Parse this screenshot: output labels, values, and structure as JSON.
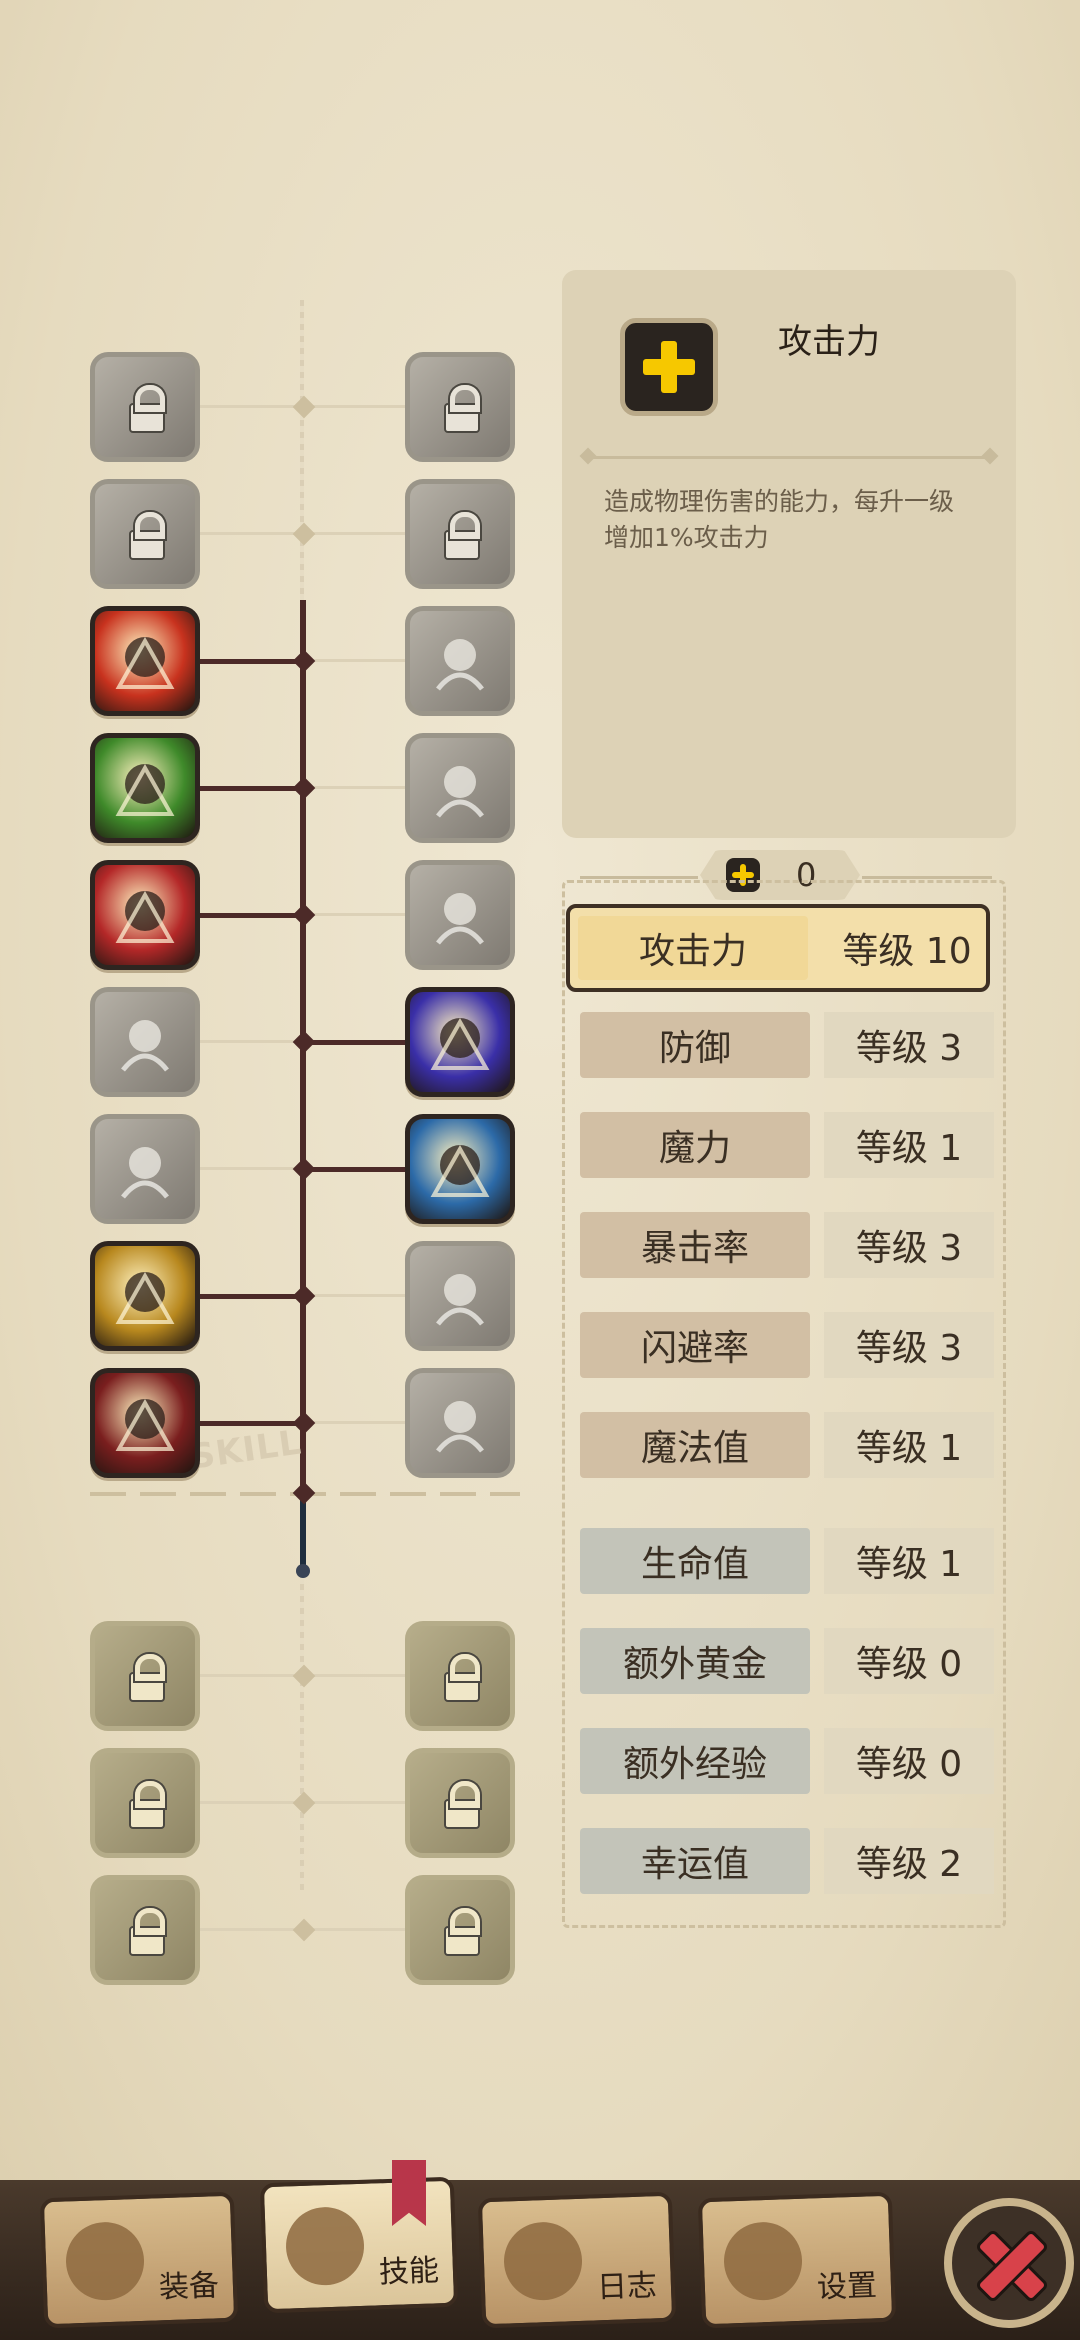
{
  "skill_tree": {
    "watermark": "SKILL",
    "upper_left": [
      {
        "icon": "lightning-wolf-icon",
        "state": "locked"
      },
      {
        "icon": "skull-bird-icon",
        "state": "locked"
      },
      {
        "icon": "fire-rage-icon",
        "state": "unlocked",
        "color": "#c8321e"
      },
      {
        "icon": "green-strength-icon",
        "state": "unlocked",
        "color": "#3f8a2a"
      },
      {
        "icon": "red-slash-icon",
        "state": "unlocked",
        "color": "#b42828"
      },
      {
        "icon": "sword-icon",
        "state": "locked-grey"
      },
      {
        "icon": "whirlwind-icon",
        "state": "locked-grey"
      },
      {
        "icon": "golden-rage-icon",
        "state": "unlocked",
        "color": "#b8881e"
      },
      {
        "icon": "crossed-swords-icon",
        "state": "unlocked",
        "color": "#7a1e1e"
      }
    ],
    "upper_right": [
      {
        "icon": "shield-crest-icon",
        "state": "locked"
      },
      {
        "icon": "blade-storm-icon",
        "state": "locked"
      },
      {
        "icon": "lightning-icon",
        "state": "locked-grey"
      },
      {
        "icon": "dash-icon",
        "state": "locked-grey"
      },
      {
        "icon": "smoke-bomb-icon",
        "state": "locked-grey"
      },
      {
        "icon": "purple-eye-icon",
        "state": "unlocked",
        "color": "#3a2fa8"
      },
      {
        "icon": "ice-blade-icon",
        "state": "unlocked",
        "color": "#2c6aa8"
      },
      {
        "icon": "explosion-icon",
        "state": "locked-grey"
      },
      {
        "icon": "sparkle-icon",
        "state": "locked-grey"
      }
    ],
    "lower_left": [
      {
        "icon": "bag-lock-icon",
        "state": "locked"
      },
      {
        "icon": "crest-lock-icon",
        "state": "locked"
      },
      {
        "icon": "horned-lock-icon",
        "state": "locked"
      }
    ],
    "lower_right": [
      {
        "icon": "eye-lock-icon",
        "state": "locked"
      },
      {
        "icon": "eye-wing-lock-icon",
        "state": "locked"
      },
      {
        "icon": "chain-lock-icon",
        "state": "locked"
      }
    ]
  },
  "info": {
    "title": "攻击力",
    "description": "造成物理伤害的能力，每升一级增加1%攻击力",
    "icon": "yellow-plus-icon"
  },
  "points": {
    "value": "0"
  },
  "stats": [
    {
      "name": "攻击力",
      "level": "等级 10",
      "group": "selected"
    },
    {
      "name": "防御",
      "level": "等级 3",
      "group": "red"
    },
    {
      "name": "魔力",
      "level": "等级 1",
      "group": "red"
    },
    {
      "name": "暴击率",
      "level": "等级 3",
      "group": "red"
    },
    {
      "name": "闪避率",
      "level": "等级 3",
      "group": "red"
    },
    {
      "name": "魔法值",
      "level": "等级 1",
      "group": "red"
    },
    {
      "name": "生命值",
      "level": "等级 1",
      "group": "blue"
    },
    {
      "name": "额外黄金",
      "level": "等级 0",
      "group": "blue"
    },
    {
      "name": "额外经验",
      "level": "等级 0",
      "group": "blue"
    },
    {
      "name": "幸运值",
      "level": "等级 2",
      "group": "blue"
    }
  ],
  "nav": {
    "tabs": [
      {
        "label": "装备",
        "icon": "axe-icon"
      },
      {
        "label": "技能",
        "icon": "skill-ring-icon",
        "active": true
      },
      {
        "label": "日志",
        "icon": "scroll-icon"
      },
      {
        "label": "设置",
        "icon": "gear-icon"
      }
    ],
    "close_icon": "close-x-icon"
  }
}
